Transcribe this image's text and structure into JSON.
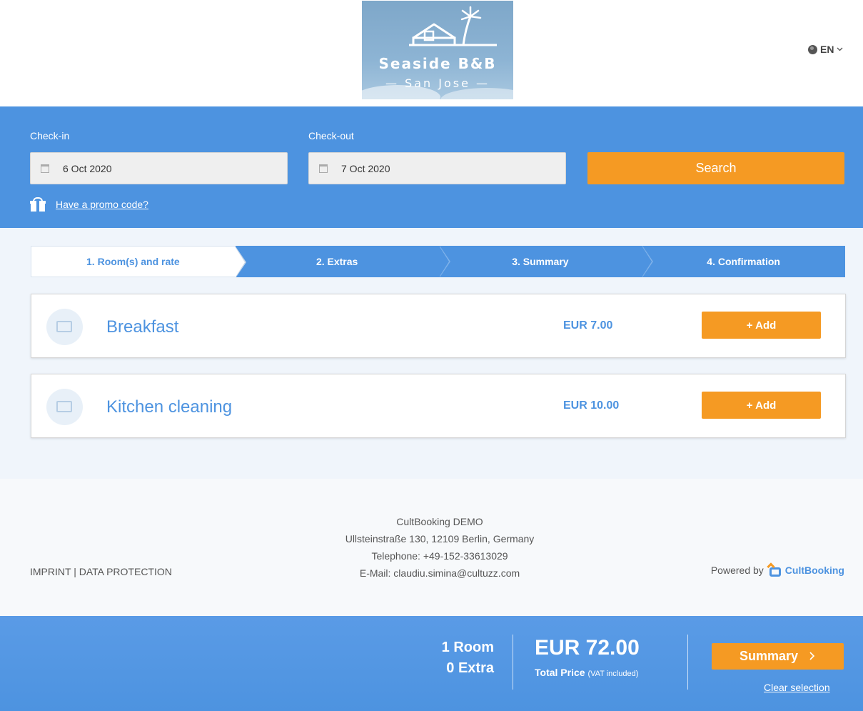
{
  "header": {
    "logo": {
      "title": "Seaside B&B",
      "subtitle": "— San Jose —"
    },
    "language": {
      "label": "EN",
      "icon": "globe-icon"
    }
  },
  "search": {
    "checkin": {
      "label": "Check-in",
      "value": "6 Oct 2020",
      "icon": "calendar-icon"
    },
    "checkout": {
      "label": "Check-out",
      "value": "7 Oct 2020",
      "icon": "calendar-icon"
    },
    "search_label": "Search",
    "promo_label": "Have a promo code?",
    "promo_icon": "gift-icon"
  },
  "steps": [
    {
      "label": "1. Room(s) and rate"
    },
    {
      "label": "2. Extras"
    },
    {
      "label": "3. Summary"
    },
    {
      "label": "4. Confirmation"
    }
  ],
  "extras": [
    {
      "name": "Breakfast",
      "price": "EUR 7.00",
      "add_label": "+ Add"
    },
    {
      "name": "Kitchen cleaning",
      "price": "EUR 10.00",
      "add_label": "+ Add"
    }
  ],
  "footer": {
    "links": "IMPRINT | DATA PROTECTION",
    "company": "CultBooking DEMO",
    "address": "Ullsteinstraße 130, 12109 Berlin, Germany",
    "telephone": "Telephone: +49-152-33613029",
    "email": "E-Mail: claudiu.simina@cultuzz.com",
    "powered_by": "Powered by",
    "brand": "CultBooking"
  },
  "summary_bar": {
    "rooms": "1 Room",
    "extras": "0 Extra",
    "price": "EUR 72.00",
    "total_label": "Total Price",
    "vat": "(VAT included)",
    "summary_label": "Summary",
    "clear_label": "Clear selection"
  },
  "colors": {
    "primary": "#4d93e0",
    "accent": "#f59a23"
  }
}
